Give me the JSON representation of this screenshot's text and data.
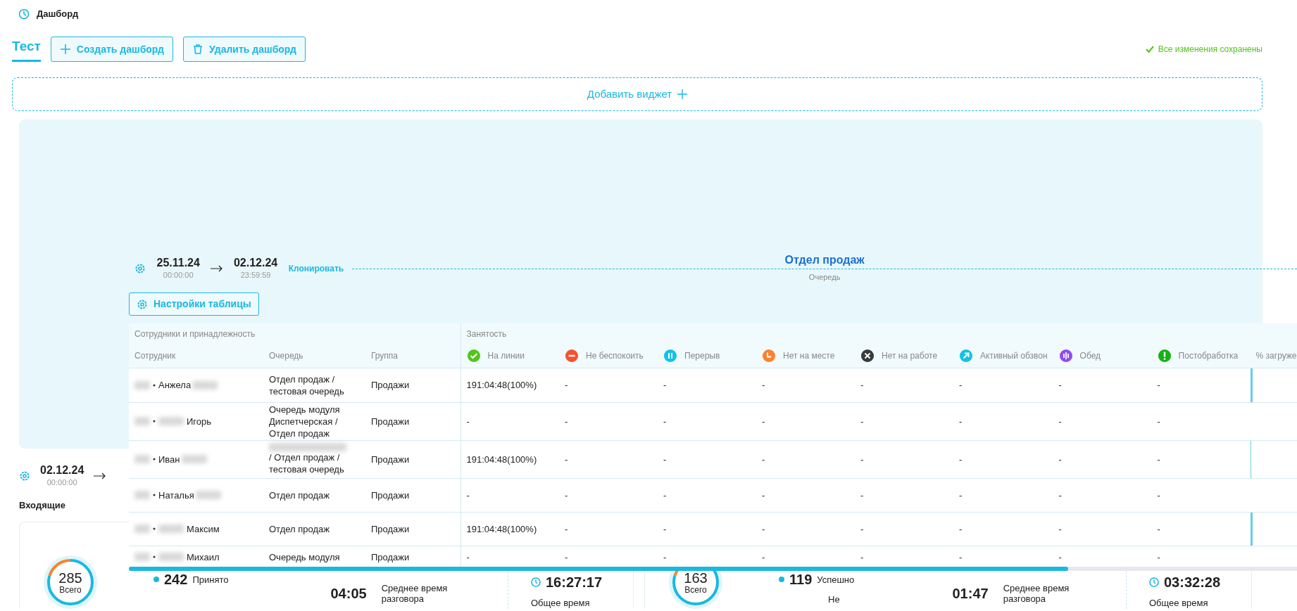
{
  "header": {
    "title": "Дашборд"
  },
  "tabs": [
    {
      "label": "Тест",
      "selected": true
    }
  ],
  "toolbar": {
    "buttons": [
      {
        "label": "Создать дашборд",
        "kind": "create"
      },
      {
        "label": "Удалить дашборд",
        "kind": "delete"
      }
    ],
    "save_status": "Все изменения сохранены"
  },
  "add_widget": {
    "label": "Добавить виджет"
  },
  "dragged_widget": {
    "date_from": "25.11.24",
    "time_from": "00:00:00",
    "date_to": "02.12.24",
    "time_to": "23:59:59",
    "clone_link": "Клонировать",
    "title": "Отдел продаж",
    "subtitle": "Очередь",
    "settings_button": "Настройки таблицы",
    "table": {
      "groups": [
        "Сотрудники и принадлежность",
        "Занятость"
      ],
      "columns": [
        "Сотрудник",
        "Очередь",
        "Группа"
      ],
      "statuses": [
        {
          "label": "На линии",
          "kind": "check",
          "color": "#52c41a"
        },
        {
          "label": "Не беспокоить",
          "kind": "minus",
          "color": "#f5522d"
        },
        {
          "label": "Перерыв",
          "kind": "pause",
          "color": "#13c2e8"
        },
        {
          "label": "Нет на месте",
          "kind": "clock",
          "color": "#fa8231"
        },
        {
          "label": "Нет на работе",
          "kind": "cross",
          "color": "#3a3a3a"
        },
        {
          "label": "Активный обзвон",
          "kind": "arrow",
          "color": "#13c2e8"
        },
        {
          "label": "Обед",
          "kind": "bars",
          "color": "#8f4cf0"
        },
        {
          "label": "Постобработка",
          "kind": "exclamation",
          "color": "#12b312"
        }
      ],
      "load_column": "% загруже",
      "rows": [
        {
          "name": "Анжела",
          "surname_before": false,
          "queue": "Отдел продаж / тестовая очередь",
          "queue_redacted": false,
          "group": "Продажи",
          "values": [
            "191:04:48(100%)",
            "-",
            "-",
            "-",
            "-",
            "-",
            "-",
            "-"
          ],
          "load": {
            "level": 0.03
          }
        },
        {
          "name": "Игорь",
          "surname_before": true,
          "queue": "Очередь модуля Диспетчерская / Отдел продаж",
          "queue_redacted": false,
          "group": "Продажи",
          "values": [
            "-",
            "-",
            "-",
            "-",
            "-",
            "-",
            "-",
            "-"
          ],
          "load": {
            "level": 0
          }
        },
        {
          "name": "Иван",
          "surname_before": false,
          "queue": "/ Отдел продаж / тестовая очередь",
          "queue_redacted": true,
          "group": "Продажи",
          "values": [
            "191:04:48(100%)",
            "-",
            "-",
            "-",
            "-",
            "-",
            "-",
            "-"
          ],
          "load": {
            "level": 0.01
          }
        },
        {
          "name": "Наталья",
          "surname_before": false,
          "queue": "Отдел продаж",
          "queue_redacted": false,
          "group": "Продажи",
          "values": [
            "-",
            "-",
            "-",
            "-",
            "-",
            "-",
            "-",
            "-"
          ],
          "load": {
            "level": 0
          }
        },
        {
          "name": "Максим",
          "surname_before": true,
          "queue": "Отдел продаж",
          "queue_redacted": false,
          "group": "Продажи",
          "values": [
            "191:04:48(100%)",
            "-",
            "-",
            "-",
            "-",
            "-",
            "-",
            "-"
          ],
          "load": {
            "level": 0.03
          }
        },
        {
          "name": "Михаил",
          "surname_before": true,
          "queue": "Очередь модуля",
          "queue_redacted": false,
          "group": "Продажи",
          "values": [
            "-",
            "-",
            "-",
            "-",
            "-",
            "-",
            "-",
            "-"
          ],
          "load": {
            "level": 0
          }
        }
      ]
    }
  },
  "background_widget": {
    "date_from": "02.12.24",
    "time_from": "00:00:00",
    "section": "Входящие",
    "cards": [
      {
        "total": "285",
        "total_label": "Всего",
        "main_value": "242",
        "main_label": "Принято",
        "avg": "04:05",
        "avg_label": "Среднее время разговора",
        "total_time": "16:27:17",
        "total_time_label": "Общее время"
      },
      {
        "total": "163",
        "total_label": "Всего",
        "main_value": "119",
        "main_label": "Успешно",
        "secondary_label": "Не",
        "avg": "01:47",
        "avg_label": "Среднее время разговора",
        "total_time": "03:32:28",
        "total_time_label": "Общее время"
      }
    ]
  }
}
